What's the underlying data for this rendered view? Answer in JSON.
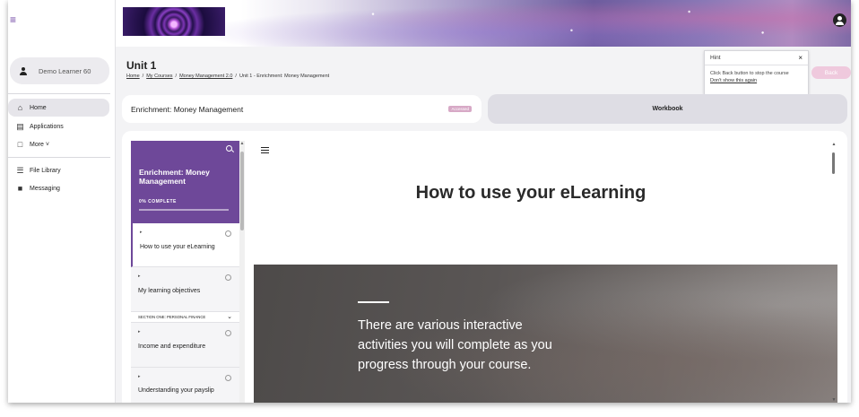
{
  "sidebar": {
    "user_name": "Demo Learner 60",
    "nav": [
      {
        "label": "Home",
        "icon": "home-icon"
      },
      {
        "label": "Applications",
        "icon": "document-icon"
      },
      {
        "label": "More ˅",
        "icon": "file-icon"
      },
      {
        "label": "File Library",
        "icon": "library-icon"
      },
      {
        "label": "Messaging",
        "icon": "chat-icon"
      }
    ]
  },
  "header": {
    "unit_title": "Unit 1",
    "breadcrumb": {
      "home": "Home",
      "courses": "My Courses",
      "course": "Money Management 2.0",
      "current": "Unit 1 - Enrichment: Money Management",
      "sep": "/"
    }
  },
  "hint": {
    "title": "Hint",
    "close": "×",
    "message": "Click Back button to stop the course",
    "dismiss": "Don't show this again"
  },
  "back_label": "Back",
  "course": {
    "name": "Enrichment: Money Management",
    "badge": "Accessed"
  },
  "workbook_label": "Workbook",
  "toc": {
    "title": "Enrichment: Money Management",
    "progress_label": "0% COMPLETE",
    "progress": 0,
    "lessons": [
      {
        "name": "How to use your eLearning",
        "current": true
      },
      {
        "name": "My learning objectives",
        "current": false
      }
    ],
    "section": "SECTION ONE: PERSONAL FINANCE",
    "section_lessons": [
      {
        "name": "Income and expenditure"
      },
      {
        "name": "Understanding your payslip"
      }
    ]
  },
  "lesson": {
    "title": "How to use your eLearning",
    "hero_text": "There are various interactive activities you will complete as you progress through your course."
  },
  "colors": {
    "brand_purple": "#6e4899",
    "back_pink": "#efc9dd"
  }
}
